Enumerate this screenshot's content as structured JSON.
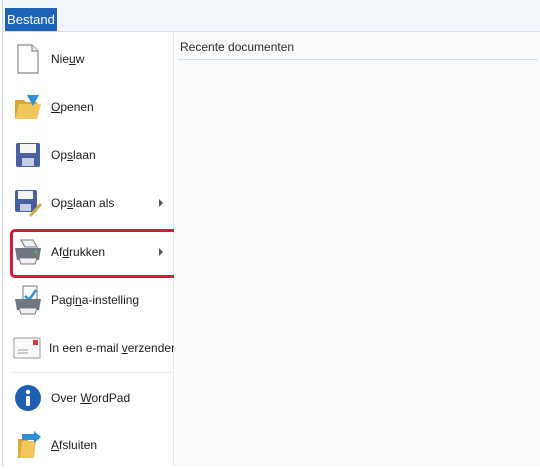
{
  "ribbon": {
    "file_tab": "Bestand"
  },
  "menu": {
    "items": [
      {
        "label_pre": "Nie",
        "label_key": "u",
        "label_post": "w",
        "icon": "new-document-icon",
        "submenu": false
      },
      {
        "label_pre": "",
        "label_key": "O",
        "label_post": "penen",
        "icon": "open-folder-icon",
        "submenu": false
      },
      {
        "label_pre": "Op",
        "label_key": "s",
        "label_post": "laan",
        "icon": "save-icon",
        "submenu": false
      },
      {
        "label_pre": "Op",
        "label_key": "s",
        "label_post": "laan als",
        "icon": "save-as-icon",
        "submenu": true
      },
      {
        "label_pre": "Af",
        "label_key": "d",
        "label_post": "rukken",
        "icon": "printer-icon",
        "submenu": true
      },
      {
        "label_pre": "Pagi",
        "label_key": "n",
        "label_post": "a-instelling",
        "icon": "page-setup-icon",
        "submenu": false
      },
      {
        "label_pre": "In een e-mail ",
        "label_key": "v",
        "label_post": "erzenden",
        "icon": "email-icon",
        "submenu": false
      },
      {
        "label_pre": "Over ",
        "label_key": "W",
        "label_post": "ordPad",
        "icon": "info-icon",
        "submenu": false
      },
      {
        "label_pre": "",
        "label_key": "A",
        "label_post": "fsluiten",
        "icon": "exit-icon",
        "submenu": false
      }
    ]
  },
  "recent": {
    "title": "Recente documenten"
  },
  "colors": {
    "file_tab": "#1e63b8",
    "highlight": "#d8193a"
  }
}
